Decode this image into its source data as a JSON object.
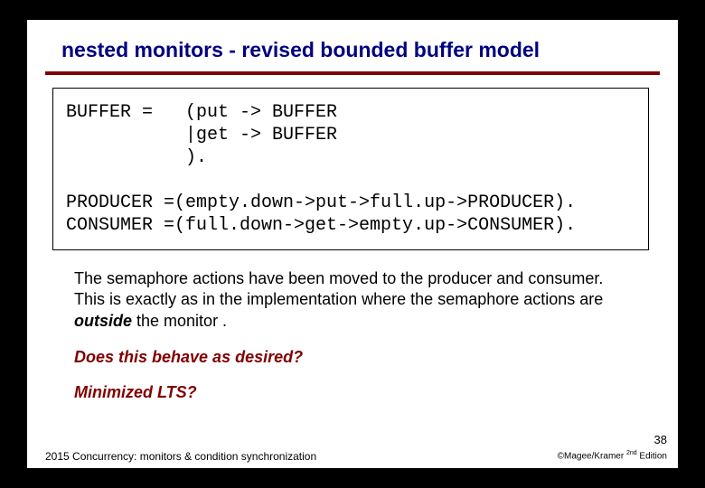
{
  "title": "nested monitors - revised bounded buffer model",
  "code": {
    "l1": "BUFFER =   (put -> BUFFER",
    "l2": "           |get -> BUFFER",
    "l3": "           ).",
    "l4": "",
    "l5": "PRODUCER =(empty.down->put->full.up->PRODUCER).",
    "l6": "CONSUMER =(full.down->get->empty.up->CONSUMER)."
  },
  "body": {
    "pre": "The semaphore actions have been moved to the producer and consumer. This is exactly as in the implementation where the semaphore actions are ",
    "emph": "outside",
    "post": " the monitor ."
  },
  "question1": "Does this behave as desired?",
  "question2": "Minimized LTS?",
  "page_number": "38",
  "footer_left": "2015  Concurrency: monitors & condition synchronization",
  "footer_right_pre": "©Magee/Kramer ",
  "footer_right_sup": "2nd",
  "footer_right_post": " Edition"
}
